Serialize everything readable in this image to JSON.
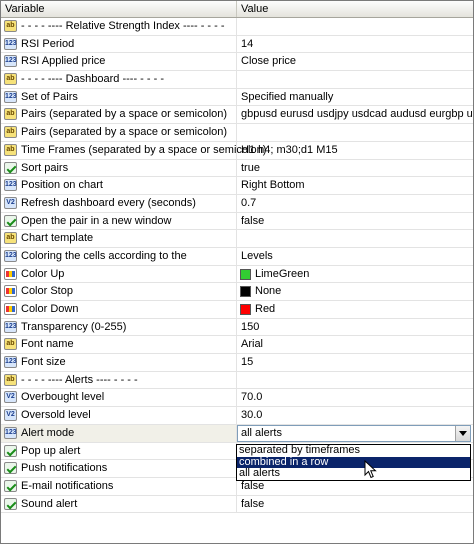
{
  "header": {
    "col_variable": "Variable",
    "col_value": "Value"
  },
  "rows": [
    {
      "icon": "ab",
      "label": "- - - - ---- Relative Strength Index ---- - - - -",
      "value": ""
    },
    {
      "icon": "123",
      "label": "RSI Period",
      "value": "14"
    },
    {
      "icon": "123",
      "label": "RSI Applied price",
      "value": "Close price"
    },
    {
      "icon": "ab",
      "label": "- - - - ---- Dashboard ---- - - - -",
      "value": ""
    },
    {
      "icon": "123",
      "label": "Set of Pairs",
      "value": "Specified manually"
    },
    {
      "icon": "ab",
      "label": "Pairs (separated by a space or semicolon)",
      "value": "gbpusd eurusd usdjpy usdcad audusd eurgbp usdch..."
    },
    {
      "icon": "ab",
      "label": "Pairs (separated by a space or semicolon)",
      "value": ""
    },
    {
      "icon": "ab",
      "label": "Time Frames (separated by a space or semicolon)",
      "value": "H1 h4; m30;d1 M15"
    },
    {
      "icon": "bool",
      "label": "Sort pairs",
      "value": "true"
    },
    {
      "icon": "123",
      "label": "Position on chart",
      "value": "Right Bottom"
    },
    {
      "icon": "va",
      "label": "Refresh dashboard every (seconds)",
      "value": "0.7"
    },
    {
      "icon": "bool",
      "label": "Open the pair in a new window",
      "value": "false"
    },
    {
      "icon": "ab",
      "label": "Chart template",
      "value": ""
    },
    {
      "icon": "123",
      "label": "Coloring the cells according to the",
      "value": "Levels"
    },
    {
      "icon": "clr",
      "label": "Color Up",
      "value": "LimeGreen",
      "swatch": "#32cd32"
    },
    {
      "icon": "clr",
      "label": "Color Stop",
      "value": "None",
      "swatch": "#000000"
    },
    {
      "icon": "clr",
      "label": "Color Down",
      "value": "Red",
      "swatch": "#ff0000"
    },
    {
      "icon": "123",
      "label": "Transparency (0-255)",
      "value": "150"
    },
    {
      "icon": "ab",
      "label": "Font name",
      "value": "Arial"
    },
    {
      "icon": "123",
      "label": "Font size",
      "value": "15"
    },
    {
      "icon": "ab",
      "label": "- - - - ---- Alerts ---- - - - -",
      "value": ""
    },
    {
      "icon": "va",
      "label": "Overbought level",
      "value": "70.0"
    },
    {
      "icon": "va",
      "label": "Oversold level",
      "value": "30.0"
    },
    {
      "icon": "123",
      "label": "Alert mode",
      "value": "all alerts",
      "combo": true
    },
    {
      "icon": "bool",
      "label": "Pop up alert",
      "value": ""
    },
    {
      "icon": "bool",
      "label": "Push notifications",
      "value": ""
    },
    {
      "icon": "bool",
      "label": "E-mail notifications",
      "value": "false"
    },
    {
      "icon": "bool",
      "label": "Sound alert",
      "value": "false"
    }
  ],
  "dropdown": {
    "options": [
      "separated by timeframes",
      "combined in a row",
      "all alerts"
    ],
    "highlighted_index": 1
  }
}
